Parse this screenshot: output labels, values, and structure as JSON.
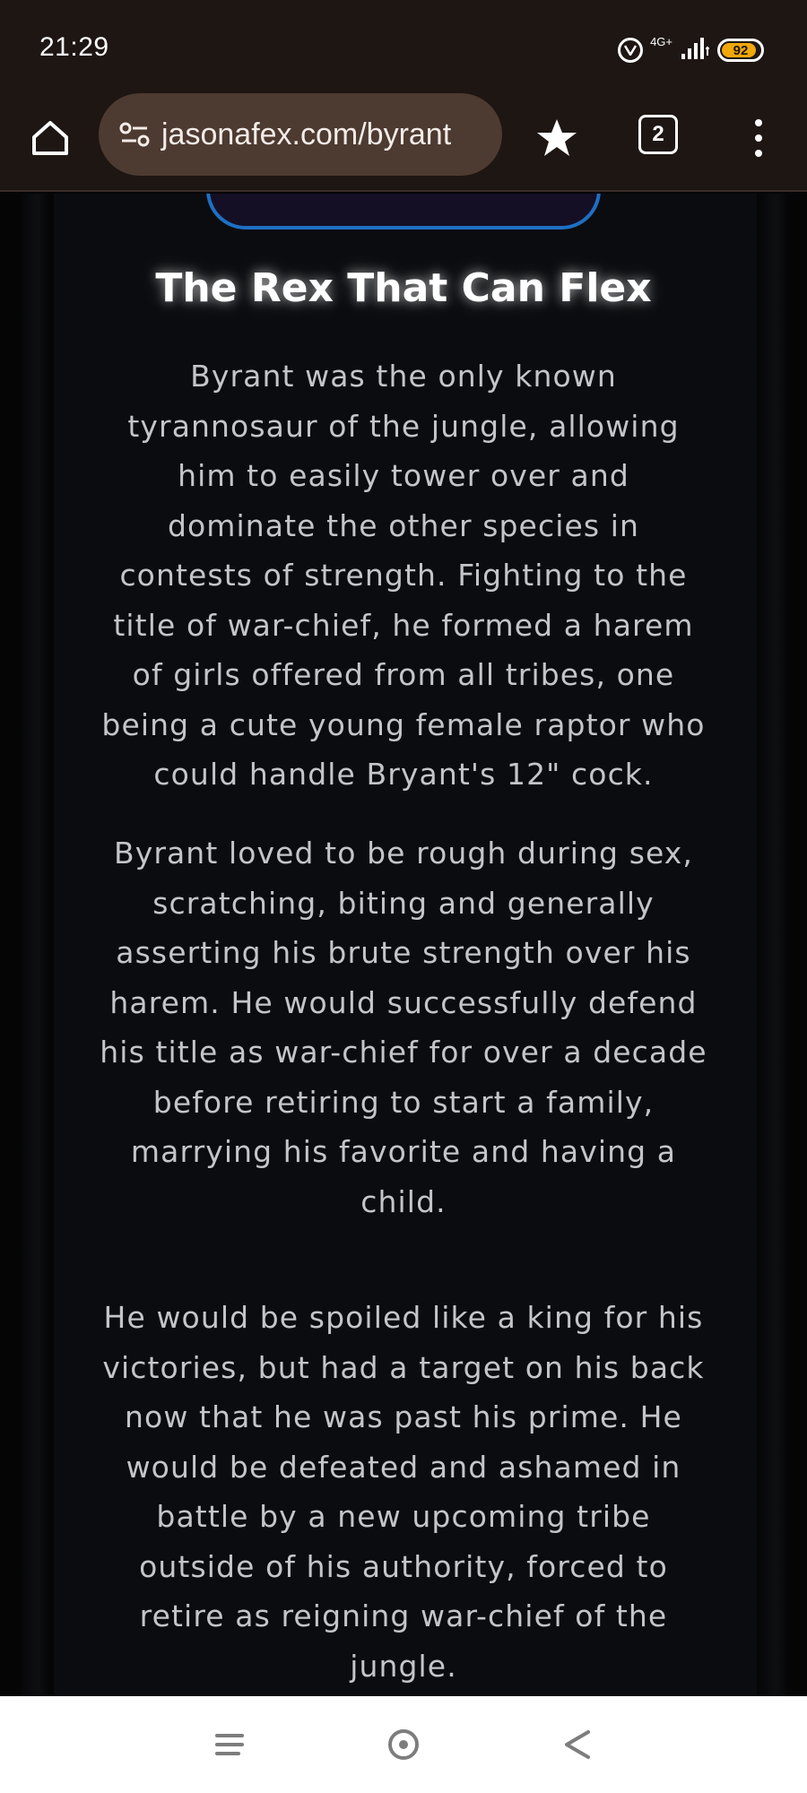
{
  "status_bar": {
    "time": "21:29",
    "network_label": "4G+",
    "battery_percent": 92,
    "battery_text": "92"
  },
  "browser": {
    "url": "jasonafex.com/byrant",
    "tab_count": "2"
  },
  "article": {
    "title": "The Rex That Can Flex",
    "paragraphs": [
      "Byrant was the only known tyrannosaur of the jungle, allowing him to easily tower over and dominate the other species in contests of strength. Fighting to the title of war-chief, he formed a harem of girls offered from all tribes, one being a cute young female raptor who could handle Bryant's 12\" cock.",
      "Byrant loved to be rough during sex, scratching, biting and generally asserting his brute strength over his harem. He would successfully defend his title as war-chief for over a decade before retiring to start a family, marrying his favorite and having a child.",
      "He would be spoiled like a king for his victories, but had a target on his back now that he was past his prime. He would be defeated and ashamed in battle by a new upcoming tribe outside of his authority, forced to retire as reigning war-chief of the jungle."
    ]
  },
  "colors": {
    "chrome_bg": "#1e1613",
    "url_bar_bg": "#4d3a30",
    "battery": "#f0a70a",
    "frame_border": "#1e6fc4",
    "body_text": "#c4c5c9"
  },
  "icons": {
    "home": "home-icon",
    "site_settings": "site-settings-icon",
    "bookmark": "star-icon",
    "tabs": "tab-switcher-icon",
    "menu": "more-vert-icon",
    "vpn": "vpn-icon",
    "signal": "signal-icon",
    "battery": "battery-icon",
    "nav_recents": "recents-icon",
    "nav_home": "circle-home-icon",
    "nav_back": "back-triangle-icon"
  }
}
